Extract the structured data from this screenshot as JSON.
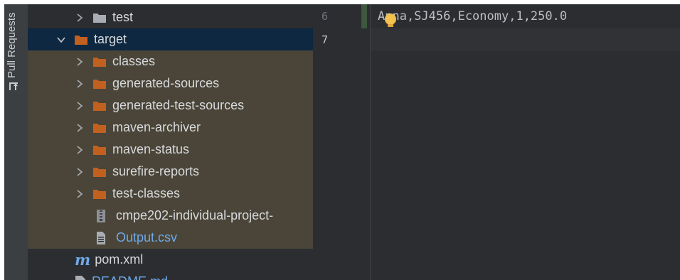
{
  "tool_strip": {
    "pull_requests_label": "Pull Requests"
  },
  "tree": {
    "rows": [
      {
        "label": "test",
        "kind": "folder-gray",
        "expanded": false
      },
      {
        "label": "target",
        "kind": "folder-orange",
        "expanded": true
      },
      {
        "label": "classes",
        "kind": "folder-orange",
        "expanded": false
      },
      {
        "label": "generated-sources",
        "kind": "folder-orange",
        "expanded": false
      },
      {
        "label": "generated-test-sources",
        "kind": "folder-orange",
        "expanded": false
      },
      {
        "label": "maven-archiver",
        "kind": "folder-orange",
        "expanded": false
      },
      {
        "label": "maven-status",
        "kind": "folder-orange",
        "expanded": false
      },
      {
        "label": "surefire-reports",
        "kind": "folder-orange",
        "expanded": false
      },
      {
        "label": "test-classes",
        "kind": "folder-orange",
        "expanded": false
      },
      {
        "label": "cmpe202-individual-project-",
        "kind": "jar-file"
      },
      {
        "label": "Output.csv",
        "kind": "csv-file"
      },
      {
        "label": "pom.xml",
        "kind": "maven-file"
      },
      {
        "label": "README.md",
        "kind": "md-file"
      }
    ]
  },
  "editor": {
    "line_numbers": [
      "6",
      "7"
    ],
    "line6_text": "Anna,SJ456,Economy,1,250.0"
  },
  "colors": {
    "background": "#2b2d30",
    "selection": "#0d2840",
    "highlight": "#4a4538",
    "folder_orange": "#c2601f",
    "folder_gray": "#a9adb3",
    "link_blue": "#6ea9e8"
  }
}
